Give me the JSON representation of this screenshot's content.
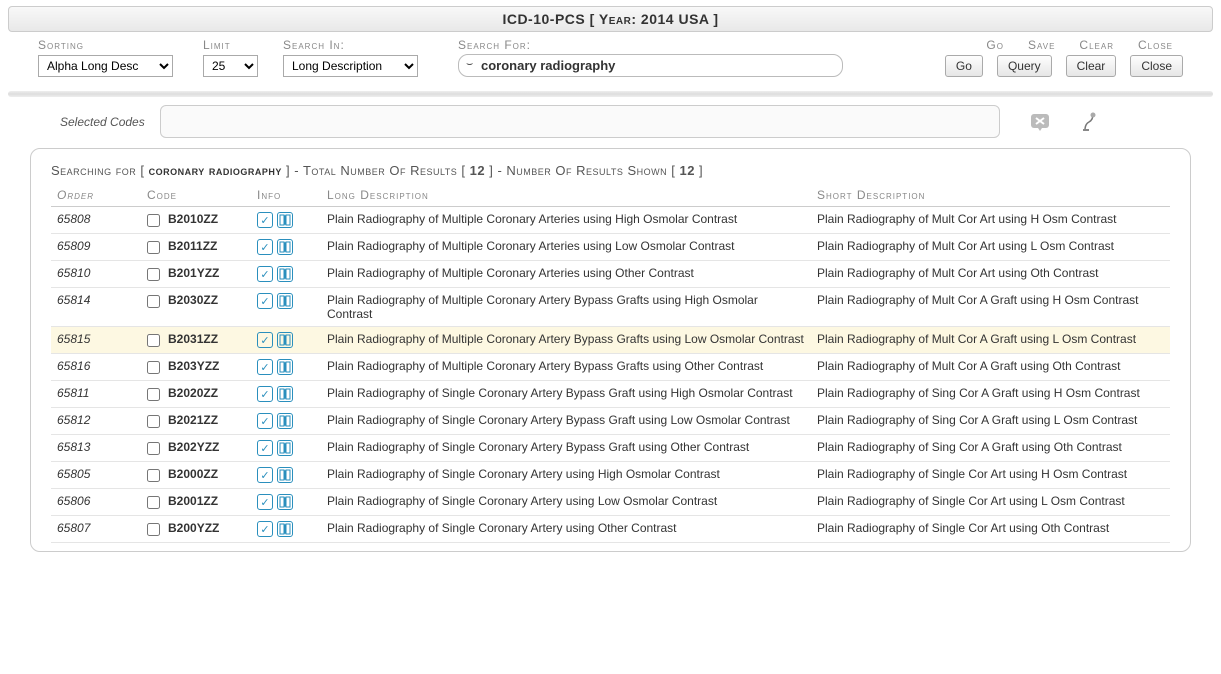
{
  "header": {
    "title": "ICD-10-PCS [ Year: 2014 USA ]"
  },
  "toolbar": {
    "labels": {
      "sorting": "Sorting",
      "limit": "Limit",
      "searchIn": "Search In:",
      "searchFor": "Search For:",
      "go": "Go",
      "save": "Save",
      "clear": "Clear",
      "close": "Close"
    },
    "sorting": "Alpha Long Desc",
    "limit": "25",
    "searchIn": "Long Description",
    "searchFor": "coronary radiography",
    "buttons": {
      "go": "Go",
      "save": "Query",
      "clear": "Clear",
      "close": "Close"
    }
  },
  "selectedCodes": {
    "label": "Selected Codes",
    "value": ""
  },
  "results": {
    "searchingPrefix": "Searching for [ ",
    "term": "coronary radiography",
    "mid1": " ] - Total Number Of Results [ ",
    "total": "12",
    "mid2": " ] - Number Of Results Shown [ ",
    "shown": "12",
    "suffix": " ]",
    "headers": {
      "order": "Order",
      "code": "Code",
      "info": "Info",
      "long": "Long Description",
      "short": "Short Description"
    },
    "rows": [
      {
        "order": "65808",
        "code": "B2010ZZ",
        "long": "Plain Radiography of Multiple Coronary Arteries using High Osmolar Contrast",
        "short": "Plain Radiography of Mult Cor Art using H Osm Contrast"
      },
      {
        "order": "65809",
        "code": "B2011ZZ",
        "long": "Plain Radiography of Multiple Coronary Arteries using Low Osmolar Contrast",
        "short": "Plain Radiography of Mult Cor Art using L Osm Contrast"
      },
      {
        "order": "65810",
        "code": "B201YZZ",
        "long": "Plain Radiography of Multiple Coronary Arteries using Other Contrast",
        "short": "Plain Radiography of Mult Cor Art using Oth Contrast"
      },
      {
        "order": "65814",
        "code": "B2030ZZ",
        "long": "Plain Radiography of Multiple Coronary Artery Bypass Grafts using High Osmolar Contrast",
        "short": "Plain Radiography of Mult Cor A Graft using H Osm Contrast"
      },
      {
        "order": "65815",
        "code": "B2031ZZ",
        "long": "Plain Radiography of Multiple Coronary Artery Bypass Grafts using Low Osmolar Contrast",
        "short": "Plain Radiography of Mult Cor A Graft using L Osm Contrast",
        "hl": true
      },
      {
        "order": "65816",
        "code": "B203YZZ",
        "long": "Plain Radiography of Multiple Coronary Artery Bypass Grafts using Other Contrast",
        "short": "Plain Radiography of Mult Cor A Graft using Oth Contrast"
      },
      {
        "order": "65811",
        "code": "B2020ZZ",
        "long": "Plain Radiography of Single Coronary Artery Bypass Graft using High Osmolar Contrast",
        "short": "Plain Radiography of Sing Cor A Graft using H Osm Contrast"
      },
      {
        "order": "65812",
        "code": "B2021ZZ",
        "long": "Plain Radiography of Single Coronary Artery Bypass Graft using Low Osmolar Contrast",
        "short": "Plain Radiography of Sing Cor A Graft using L Osm Contrast"
      },
      {
        "order": "65813",
        "code": "B202YZZ",
        "long": "Plain Radiography of Single Coronary Artery Bypass Graft using Other Contrast",
        "short": "Plain Radiography of Sing Cor A Graft using Oth Contrast"
      },
      {
        "order": "65805",
        "code": "B2000ZZ",
        "long": "Plain Radiography of Single Coronary Artery using High Osmolar Contrast",
        "short": "Plain Radiography of Single Cor Art using H Osm Contrast"
      },
      {
        "order": "65806",
        "code": "B2001ZZ",
        "long": "Plain Radiography of Single Coronary Artery using Low Osmolar Contrast",
        "short": "Plain Radiography of Single Cor Art using L Osm Contrast"
      },
      {
        "order": "65807",
        "code": "B200YZZ",
        "long": "Plain Radiography of Single Coronary Artery using Other Contrast",
        "short": "Plain Radiography of Single Cor Art using Oth Contrast"
      }
    ]
  }
}
